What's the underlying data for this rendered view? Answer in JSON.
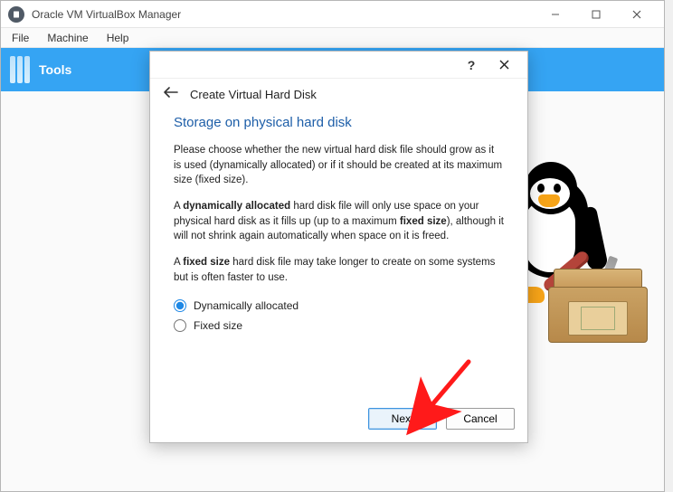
{
  "window": {
    "title": "Oracle VM VirtualBox Manager",
    "menu": [
      "File",
      "Machine",
      "Help"
    ],
    "tools_label": "Tools"
  },
  "dialog": {
    "step_title": "Create Virtual Hard Disk",
    "section_heading": "Storage on physical hard disk",
    "para1": "Please choose whether the new virtual hard disk file should grow as it is used (dynamically allocated) or if it should be created at its maximum size (fixed size).",
    "para2_pre": "A ",
    "para2_b1": "dynamically allocated",
    "para2_mid": " hard disk file will only use space on your physical hard disk as it fills up (up to a maximum ",
    "para2_b2": "fixed size",
    "para2_post": "), although it will not shrink again automatically when space on it is freed.",
    "para3_pre": "A ",
    "para3_b": "fixed size",
    "para3_post": " hard disk file may take longer to create on some systems but is often faster to use.",
    "radio_dynamic": "Dynamically allocated",
    "radio_fixed": "Fixed size",
    "radio_selected": "dynamic",
    "next_label": "Next",
    "cancel_label": "Cancel"
  }
}
